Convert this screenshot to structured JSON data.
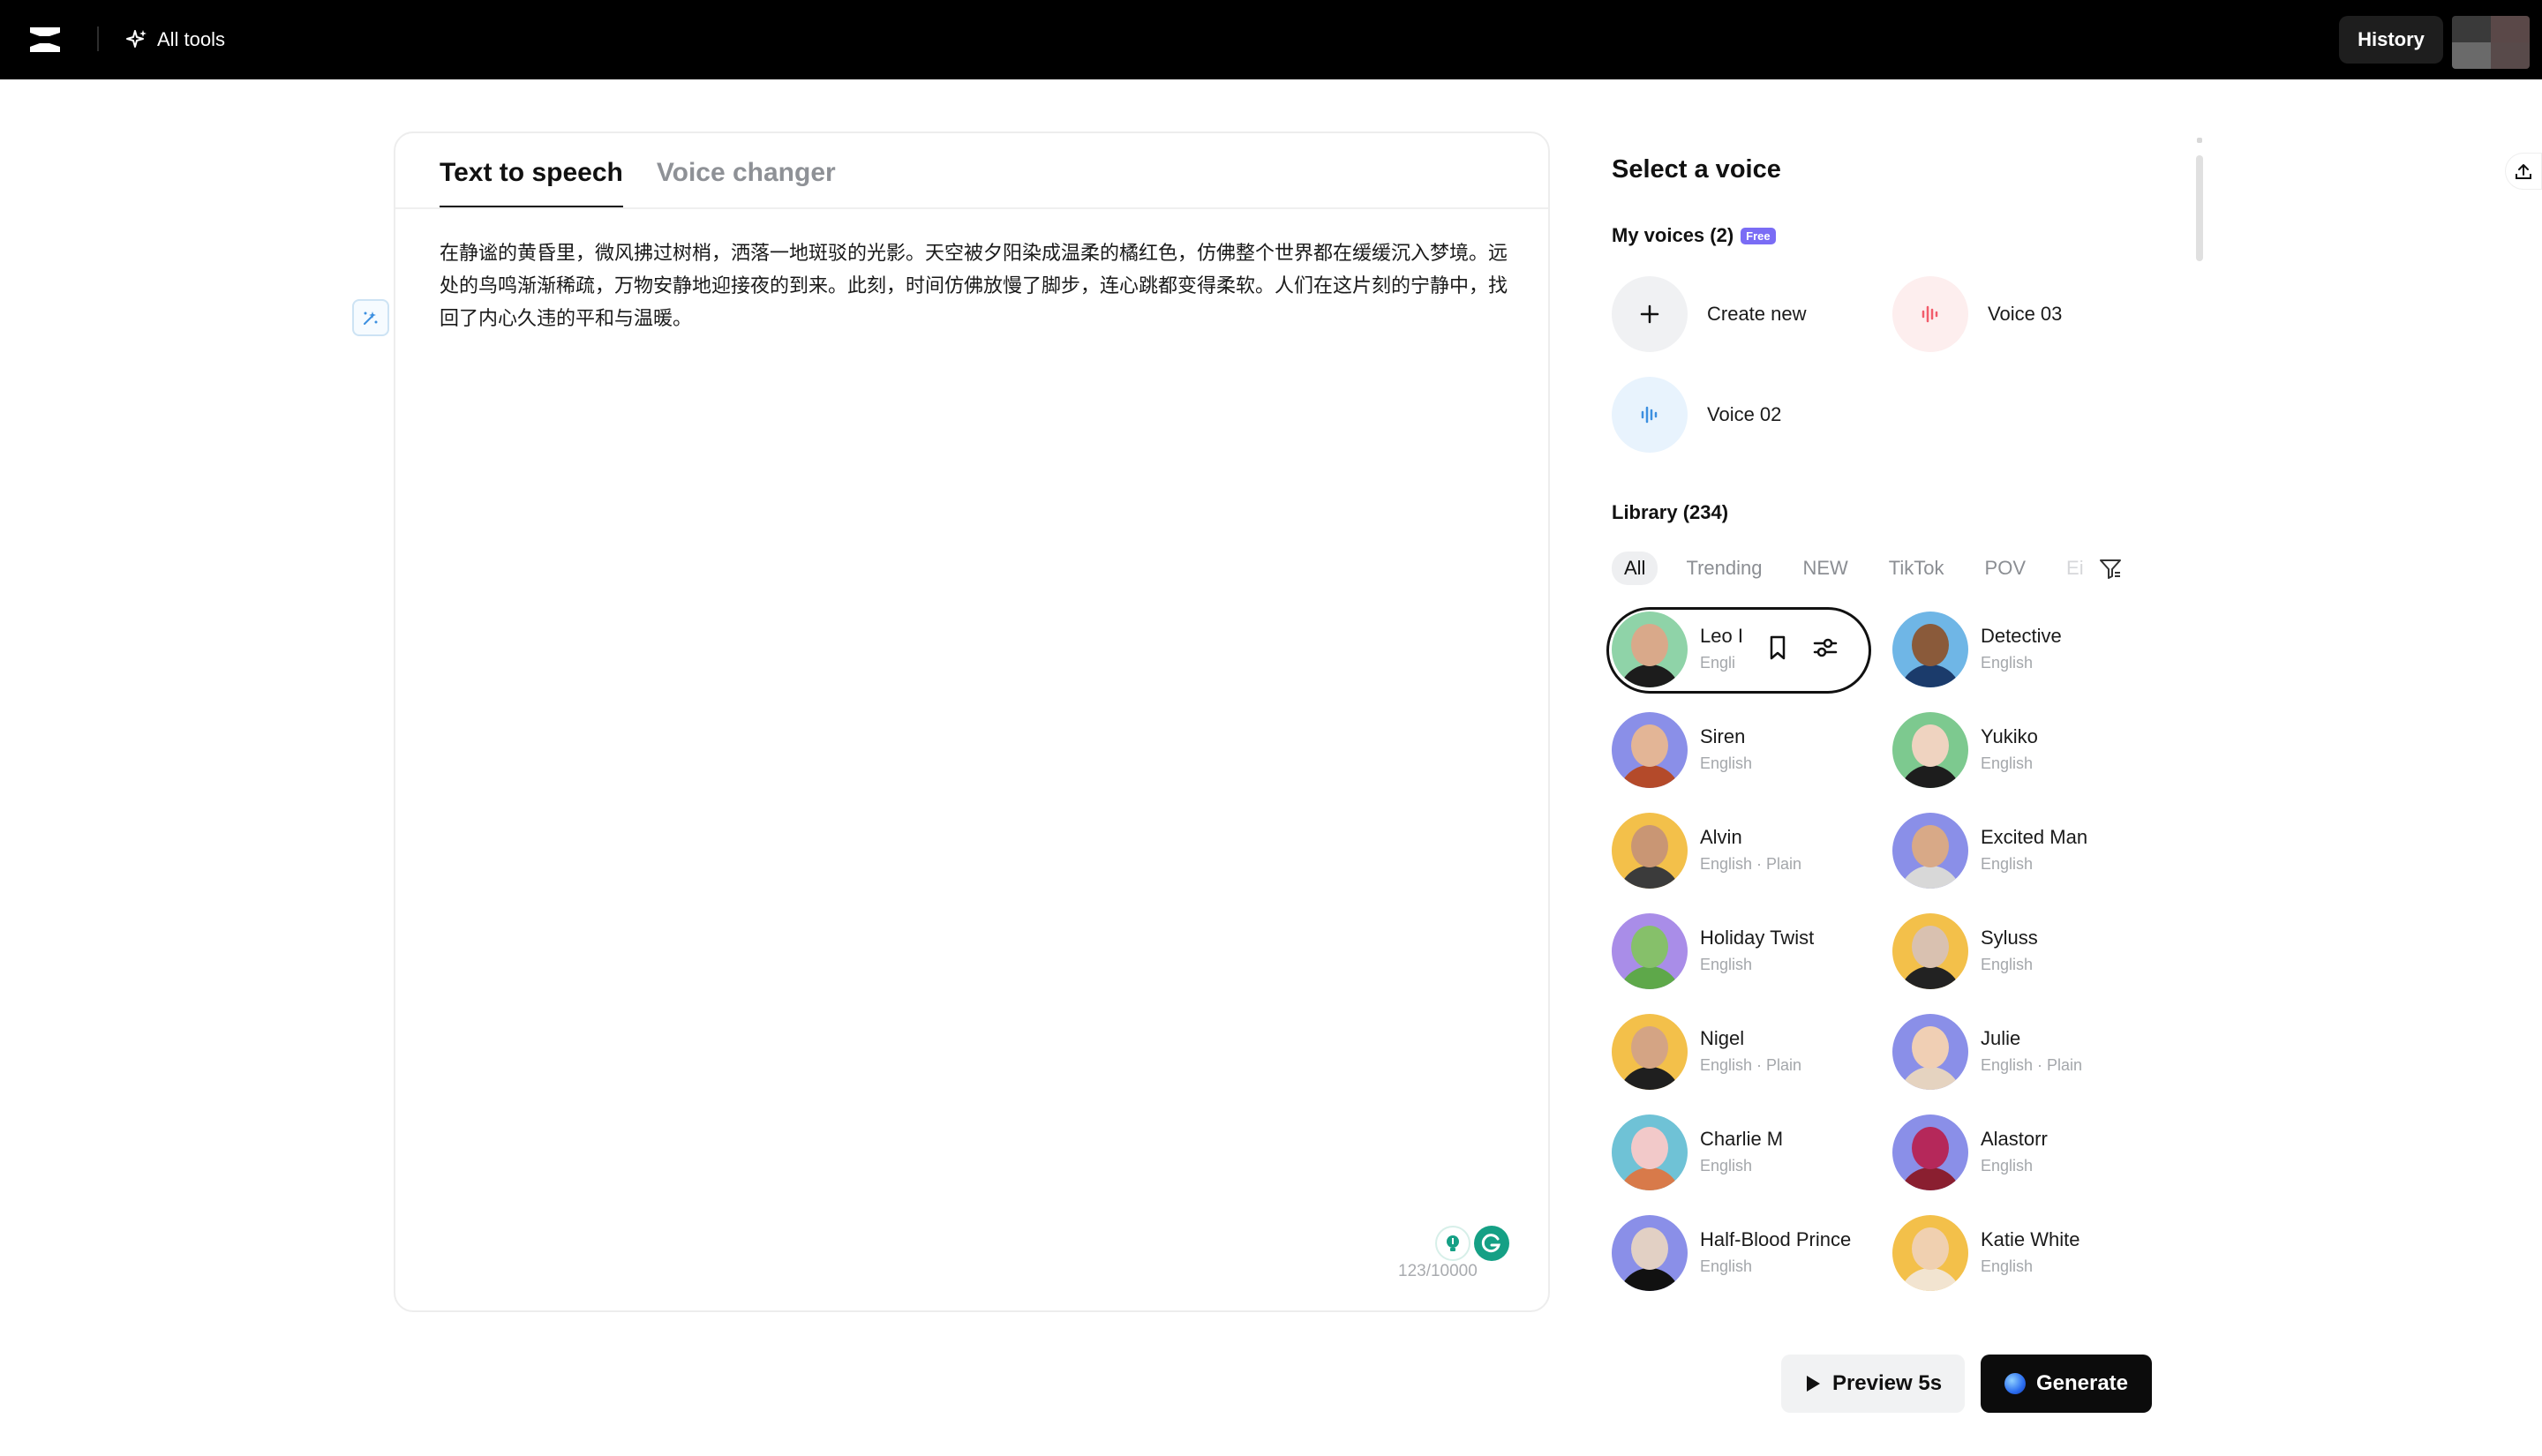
{
  "topbar": {
    "all_tools_label": "All tools",
    "history_label": "History"
  },
  "editor": {
    "tabs": [
      {
        "label": "Text to speech",
        "active": true
      },
      {
        "label": "Voice changer",
        "active": false
      }
    ],
    "text": "在静谧的黄昏里，微风拂过树梢，洒落一地斑驳的光影。天空被夕阳染成温柔的橘红色，仿佛整个世界都在缓缓沉入梦境。远处的鸟鸣渐渐稀疏，万物安静地迎接夜的到来。此刻，时间仿佛放慢了脚步，连心跳都变得柔软。人们在这片刻的宁静中，找回了内心久违的平和与温暖。",
    "char_count": "123/10000"
  },
  "voice_panel": {
    "title": "Select a voice",
    "my_voices_label": "My voices (2)",
    "free_badge": "Free",
    "my_voices": [
      {
        "label": "Create new",
        "icon": "plus-icon"
      },
      {
        "label": "Voice 03",
        "icon": "waveform-icon",
        "color": "#f25c6b"
      },
      {
        "label": "Voice 02",
        "icon": "waveform-icon",
        "color": "#3c8fe0"
      }
    ],
    "library_label": "Library (234)",
    "filters": [
      "All",
      "Trending",
      "NEW",
      "TikTok",
      "POV",
      "Ei"
    ],
    "active_filter": "All",
    "voices": [
      {
        "name": "Leo I",
        "sub": "Engli",
        "skin": "#d9a98a",
        "bg": "#8fd3a8",
        "body": "#1c1c1c"
      },
      {
        "name": "Detective",
        "sub": "English",
        "skin": "#8a5a3a",
        "bg": "#6fb6e6",
        "body": "#1b3b6b"
      },
      {
        "name": "Siren",
        "sub": "English",
        "skin": "#e3b596",
        "bg": "#8a8fe8",
        "body": "#b44a2a"
      },
      {
        "name": "Yukiko",
        "sub": "English",
        "skin": "#efd3c0",
        "bg": "#7dc98f",
        "body": "#1d1d1d"
      },
      {
        "name": "Alvin",
        "sub": "English · Plain",
        "skin": "#c99674",
        "bg": "#f3c04a",
        "body": "#3b3b3b"
      },
      {
        "name": "Excited Man",
        "sub": "English",
        "skin": "#d8a987",
        "bg": "#8a8fe8",
        "body": "#d8d8d8"
      },
      {
        "name": "Holiday Twist",
        "sub": "English",
        "skin": "#86c06a",
        "bg": "#a98de8",
        "body": "#5ea84a"
      },
      {
        "name": "Syluss",
        "sub": "English",
        "skin": "#d9c1b0",
        "bg": "#f3c04a",
        "body": "#222"
      },
      {
        "name": "Nigel",
        "sub": "English · Plain",
        "skin": "#d4a484",
        "bg": "#f3c04a",
        "body": "#1f1f1f"
      },
      {
        "name": "Julie",
        "sub": "English · Plain",
        "skin": "#f0cfb4",
        "bg": "#8a8fe8",
        "body": "#e5d3c0"
      },
      {
        "name": "Charlie M",
        "sub": "English",
        "skin": "#f2c9c9",
        "bg": "#6fc2d6",
        "body": "#d87a4a"
      },
      {
        "name": "Alastorr",
        "sub": "English",
        "skin": "#b5285a",
        "bg": "#8a8fe8",
        "body": "#8a1f30"
      },
      {
        "name": "Half-Blood Prince",
        "sub": "English",
        "skin": "#e2d0c4",
        "bg": "#8a8fe8",
        "body": "#111"
      },
      {
        "name": "Katie White",
        "sub": "English",
        "skin": "#f0d0b0",
        "bg": "#f3c04a",
        "body": "#f2e4d0"
      }
    ]
  },
  "actions": {
    "preview_label": "Preview 5s",
    "generate_label": "Generate"
  }
}
